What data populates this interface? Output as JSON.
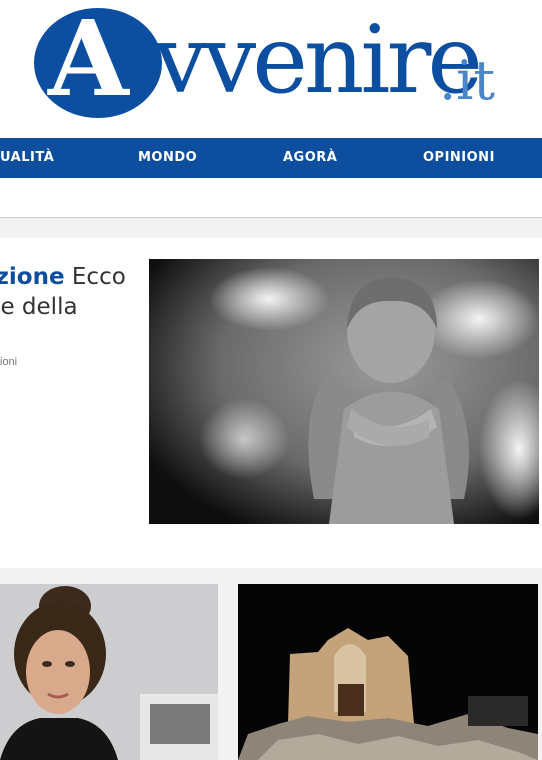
{
  "brand": {
    "logo_main": "Avvenire",
    "logo_tld": ".it",
    "colors": {
      "primary": "#0d4e9e",
      "tld": "#4a86c8"
    }
  },
  "nav": {
    "items": [
      "UALITÀ",
      "MONDO",
      "AGORÀ",
      "OPINIONI"
    ]
  },
  "feature": {
    "kicker": "azione",
    "title_rest": "Ecco ole della a",
    "meta": "ioni",
    "image_alt": "angel-statue-photo"
  },
  "cards": [
    {
      "image_alt": "woman-portrait-photo"
    },
    {
      "image_alt": "ruined-church-at-night-photo"
    }
  ]
}
